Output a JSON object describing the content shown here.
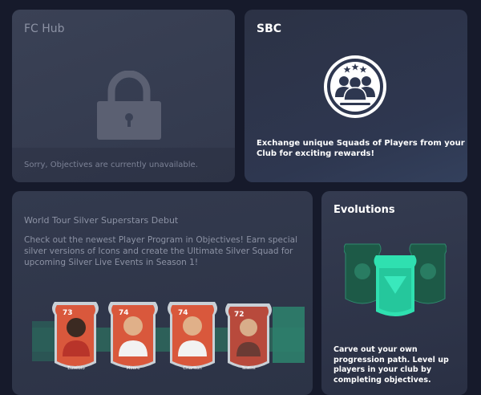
{
  "fc_hub": {
    "title": "FC Hub",
    "message": "Sorry, Objectives are currently unavailable.",
    "icon": "lock-icon"
  },
  "sbc": {
    "title": "SBC",
    "description": "Exchange unique Squads of Players from your Club for exciting rewards!",
    "icon": "sbc-squad-badge-icon"
  },
  "world_tour": {
    "title": "World Tour Silver Superstars Debut",
    "description": "Check out the newest Player Program in Objectives! Earn special silver versions of Icons and create the Ultimate Silver Squad for upcoming Silver Live Events in Season 1!",
    "cards": [
      {
        "rating": "73",
        "name": "Eusébio"
      },
      {
        "rating": "74",
        "name": "Moore"
      },
      {
        "rating": "74",
        "name": "Charlton"
      },
      {
        "rating": "72",
        "name": "Testini"
      }
    ]
  },
  "evolutions": {
    "title": "Evolutions",
    "description": "Carve out your own progression path. Level up players in your club by completing objectives."
  },
  "colors": {
    "background": "#161a2b",
    "card_red": "#d9583c",
    "evo_green": "#2fe0b0"
  }
}
